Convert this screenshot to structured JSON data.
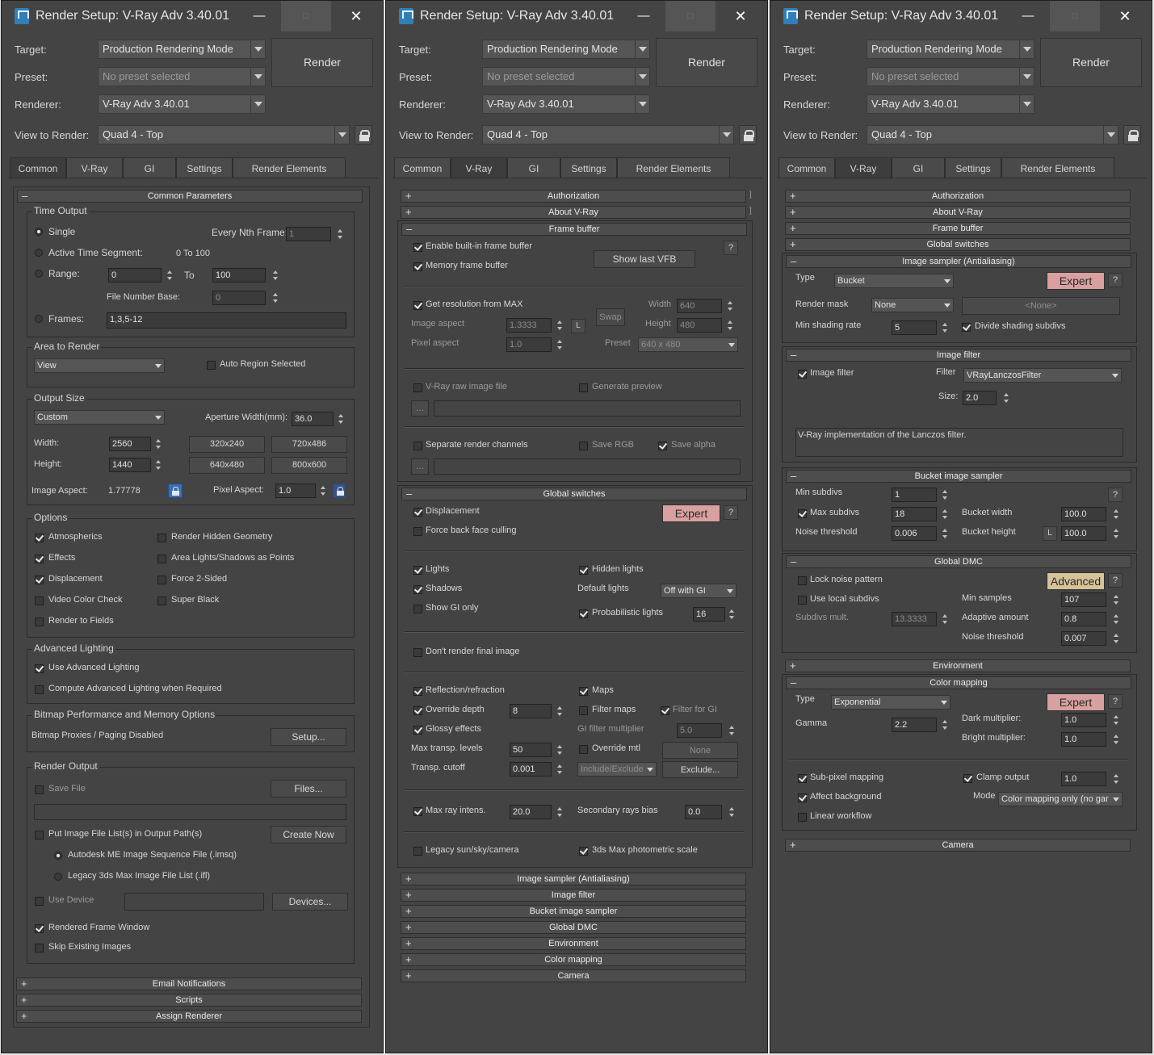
{
  "window": {
    "title": "Render Setup: V-Ray Adv 3.40.01",
    "min": "—",
    "max": "□",
    "close": "✕"
  },
  "header": {
    "target_label": "Target:",
    "target_value": "Production Rendering Mode",
    "preset_label": "Preset:",
    "preset_value": "No preset selected",
    "renderer_label": "Renderer:",
    "renderer_value": "V-Ray Adv 3.40.01",
    "view_label": "View to Render:",
    "view_value": "Quad 4 - Top",
    "render_button": "Render"
  },
  "tabs": [
    "Common",
    "V-Ray",
    "GI",
    "Settings",
    "Render Elements"
  ],
  "common": {
    "rollout_title": "Common Parameters",
    "time_output": {
      "title": "Time Output",
      "single": "Single",
      "every_nth": "Every Nth Frame:",
      "every_nth_val": "1",
      "active_segment": "Active Time Segment:",
      "active_segment_val": "0 To 100",
      "range": "Range:",
      "range_from": "0",
      "to": "To",
      "range_to": "100",
      "file_number_base": "File Number Base:",
      "file_number_base_val": "0",
      "frames": "Frames:",
      "frames_val": "1,3,5-12"
    },
    "area": {
      "title": "Area to Render",
      "value": "View",
      "auto_region": "Auto Region Selected"
    },
    "output_size": {
      "title": "Output Size",
      "preset": "Custom",
      "aperture": "Aperture Width(mm):",
      "aperture_val": "36.0",
      "width": "Width:",
      "width_val": "2560",
      "height": "Height:",
      "height_val": "1440",
      "p1": "320x240",
      "p2": "720x486",
      "p3": "640x480",
      "p4": "800x600",
      "image_aspect": "Image Aspect:",
      "image_aspect_val": "1.77778",
      "pixel_aspect": "Pixel Aspect:",
      "pixel_aspect_val": "1.0"
    },
    "options": {
      "title": "Options",
      "atmospherics": "Atmospherics",
      "effects": "Effects",
      "displacement": "Displacement",
      "video_color": "Video Color Check",
      "render_fields": "Render to Fields",
      "hidden_geo": "Render Hidden Geometry",
      "area_lights": "Area Lights/Shadows as Points",
      "force2": "Force 2-Sided",
      "super_black": "Super Black"
    },
    "adv_lighting": {
      "title": "Advanced Lighting",
      "use": "Use Advanced Lighting",
      "compute": "Compute Advanced Lighting when Required"
    },
    "bitmap": {
      "title": "Bitmap Performance and Memory Options",
      "proxies": "Bitmap Proxies / Paging Disabled",
      "setup": "Setup..."
    },
    "render_output": {
      "title": "Render Output",
      "save_file": "Save File",
      "files": "Files...",
      "put_image": "Put Image File List(s) in Output Path(s)",
      "create_now": "Create Now",
      "autodesk": "Autodesk ME Image Sequence File (.imsq)",
      "legacy": "Legacy 3ds Max Image File List (.ifl)",
      "use_device": "Use Device",
      "devices": "Devices...",
      "rfw": "Rendered Frame Window",
      "skip": "Skip Existing Images"
    },
    "bottom": [
      "Email Notifications",
      "Scripts",
      "Assign Renderer"
    ]
  },
  "vray": {
    "authorization": "Authorization",
    "about": "About V-Ray",
    "frame_buffer": "Frame buffer",
    "fb": {
      "enable_vfb": "Enable built-in frame buffer",
      "memory_fb": "Memory frame buffer",
      "show_last": "Show last VFB",
      "get_res": "Get resolution from MAX",
      "width": "Width",
      "width_val": "640",
      "swap": "Swap",
      "image_aspect": "Image aspect",
      "image_aspect_val": "1.3333",
      "l": "L",
      "height": "Height",
      "height_val": "480",
      "pixel_aspect": "Pixel aspect",
      "pixel_aspect_val": "1.0",
      "preset": "Preset",
      "preset_val": "640 x 480",
      "raw": "V-Ray raw image file",
      "gen_preview": "Generate preview",
      "dots": "...",
      "sep_channels": "Separate render channels",
      "save_rgb": "Save RGB",
      "save_alpha": "Save alpha"
    },
    "global_switches": "Global switches",
    "gs": {
      "displacement": "Displacement",
      "expert": "Expert",
      "q": "?",
      "force_back": "Force back face culling",
      "lights": "Lights",
      "hidden_lights": "Hidden lights",
      "shadows": "Shadows",
      "default_lights": "Default lights",
      "default_lights_val": "Off with GI",
      "show_gi": "Show GI only",
      "prob_lights": "Probabilistic lights",
      "prob_val": "16",
      "dont_render": "Don't render final image",
      "refl": "Reflection/refraction",
      "maps": "Maps",
      "override_depth": "Override depth",
      "override_depth_val": "8",
      "filter_maps": "Filter maps",
      "filter_gi": "Filter for GI",
      "glossy": "Glossy effects",
      "gi_filter_mult": "GI filter multiplier",
      "gi_filter_mult_val": "5.0",
      "max_transp": "Max transp. levels",
      "max_transp_val": "50",
      "override_mtl": "Override mtl",
      "none": "None",
      "transp_cutoff": "Transp. cutoff",
      "transp_cutoff_val": "0.001",
      "incl_excl": "Include/Exclude",
      "exclude": "Exclude...",
      "max_ray": "Max ray intens.",
      "max_ray_val": "20.0",
      "sec_bias": "Secondary rays bias",
      "sec_bias_val": "0.0",
      "legacy_sun": "Legacy sun/sky/camera",
      "photometric": "3ds Max photometric scale"
    },
    "closed": [
      "Image sampler (Antialiasing)",
      "Image filter",
      "Bucket image sampler",
      "Global DMC",
      "Environment",
      "Color mapping",
      "Camera"
    ]
  },
  "vray2": {
    "image_sampler": "Image sampler (Antialiasing)",
    "is": {
      "type": "Type",
      "type_val": "Bucket",
      "expert": "Expert",
      "render_mask": "Render mask",
      "render_mask_val": "None",
      "none_btn": "<None>",
      "min_shading": "Min shading rate",
      "min_shading_val": "5",
      "divide": "Divide shading subdivs"
    },
    "image_filter": "Image filter",
    "if": {
      "image_filter": "Image filter",
      "filter": "Filter",
      "filter_val": "VRayLanczosFilter",
      "size": "Size:",
      "size_val": "2.0",
      "desc": "V-Ray implementation of the Lanczos filter."
    },
    "bucket": "Bucket image sampler",
    "bk": {
      "min_subdivs": "Min subdivs",
      "min_subdivs_val": "1",
      "max_subdivs": "Max subdivs",
      "max_subdivs_val": "18",
      "bucket_width": "Bucket width",
      "bucket_width_val": "100.0",
      "noise": "Noise threshold",
      "noise_val": "0.006",
      "bucket_height": "Bucket height",
      "l": "L",
      "bucket_height_val": "100.0"
    },
    "dmc": "Global DMC",
    "dm": {
      "lock": "Lock noise pattern",
      "advanced": "Advanced",
      "local": "Use local subdivs",
      "min_samples": "Min samples",
      "min_samples_val": "107",
      "subdivs_mult": "Subdivs mult.",
      "subdivs_mult_val": "13.3333",
      "adaptive": "Adaptive amount",
      "adaptive_val": "0.8",
      "noise": "Noise threshold",
      "noise_val": "0.007"
    },
    "environment": "Environment",
    "color_mapping": "Color mapping",
    "cm": {
      "type": "Type",
      "type_val": "Exponential",
      "expert": "Expert",
      "gamma": "Gamma",
      "gamma_val": "2.2",
      "dark": "Dark multiplier:",
      "dark_val": "1.0",
      "bright": "Bright multiplier:",
      "bright_val": "1.0",
      "subpixel": "Sub-pixel mapping",
      "clamp": "Clamp output",
      "clamp_val": "1.0",
      "affect_bg": "Affect background",
      "mode": "Mode",
      "mode_val": "Color mapping only (no gar",
      "linear": "Linear workflow"
    },
    "camera": "Camera"
  }
}
